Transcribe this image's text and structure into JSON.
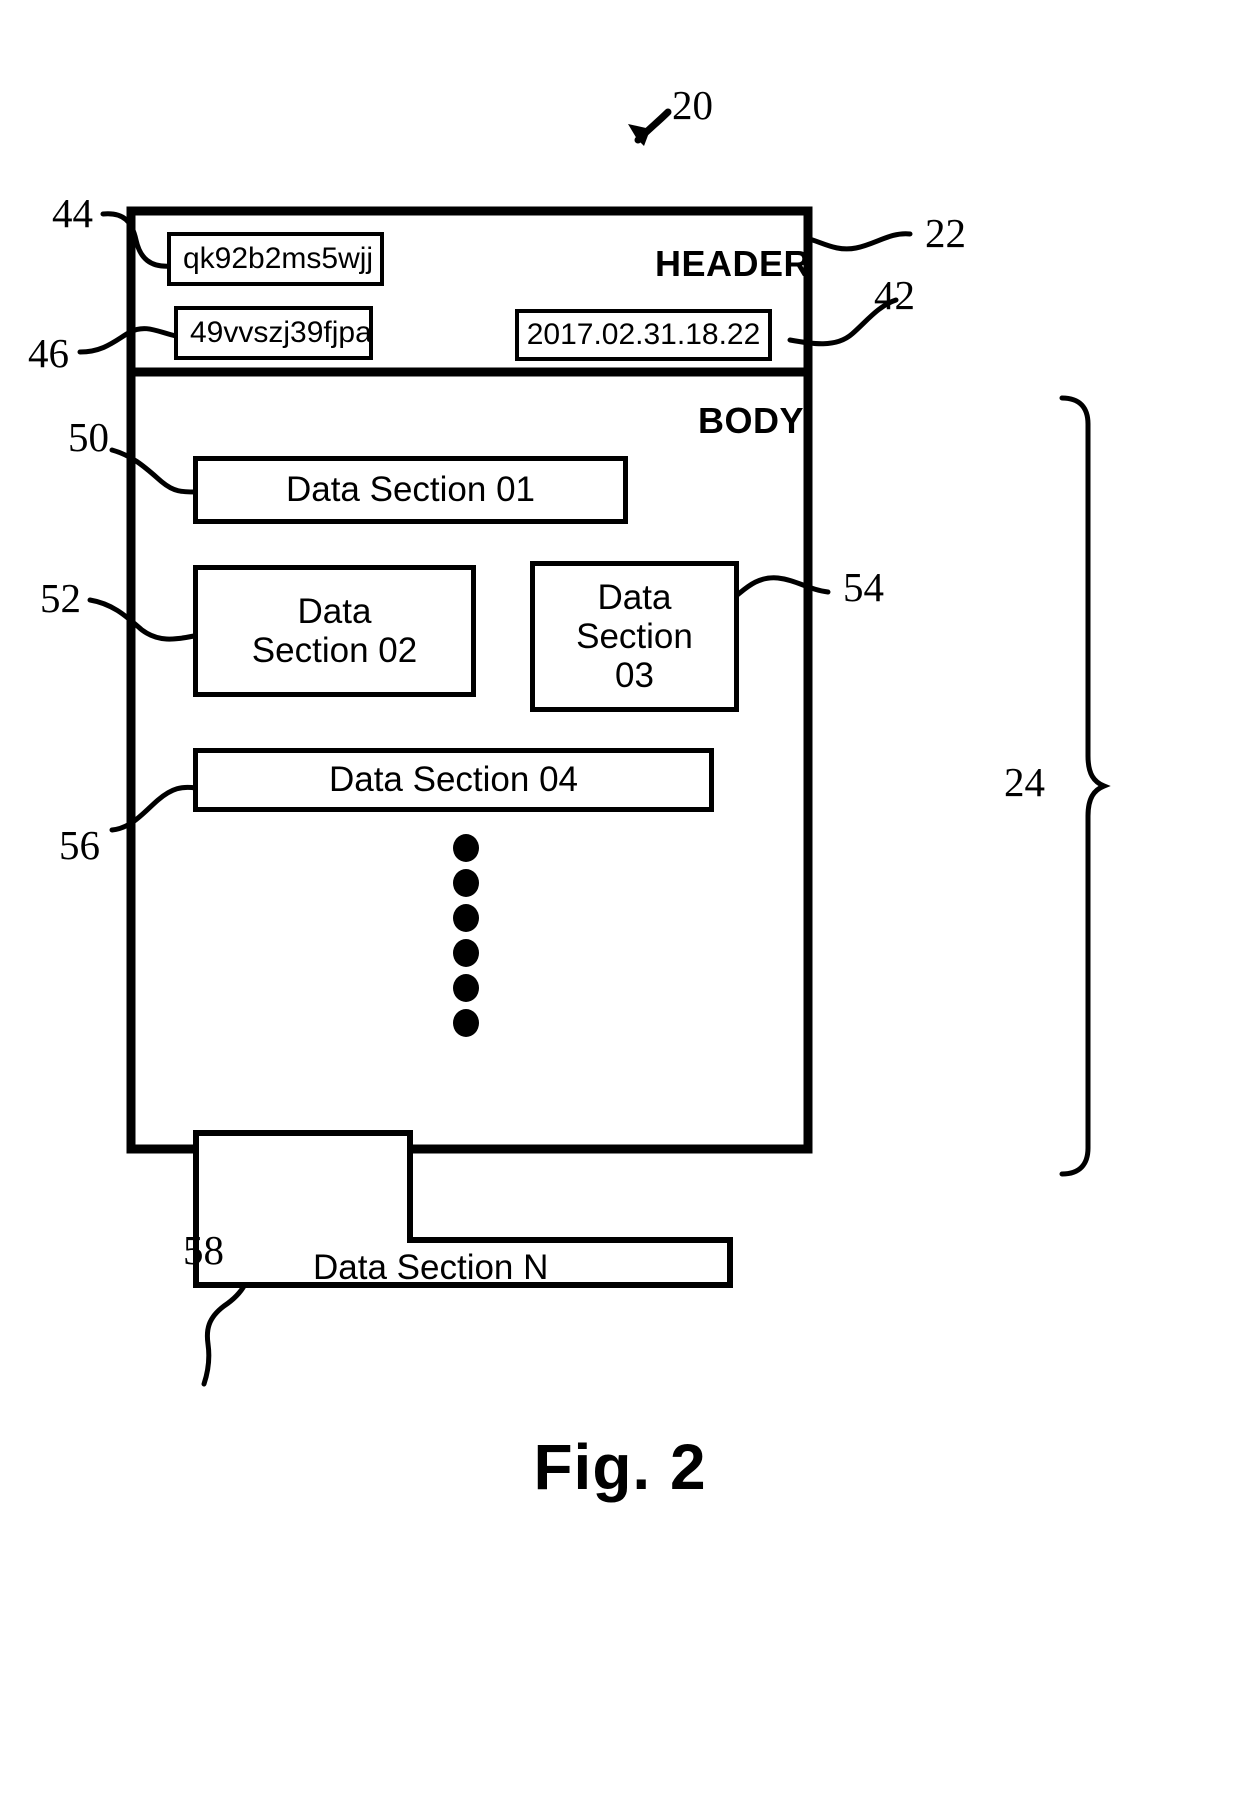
{
  "figure": {
    "caption": "Fig. 2",
    "overall_ref": "20"
  },
  "structure": {
    "header": {
      "label": "HEADER",
      "ref": "22",
      "fields": [
        {
          "ref": "44",
          "value": "qk92b2ms5wjj"
        },
        {
          "ref": "46",
          "value": "49vvszj39fjpa"
        },
        {
          "ref": "42",
          "value": "2017.02.31.18.22"
        }
      ]
    },
    "body": {
      "label": "BODY",
      "ref": "24",
      "sections": [
        {
          "ref": "50",
          "label": "Data Section 01"
        },
        {
          "ref": "52",
          "label": "Data\nSection 02"
        },
        {
          "ref": "54",
          "label": "Data\nSection\n03"
        },
        {
          "ref": "56",
          "label": "Data Section 04"
        },
        {
          "ref": "58",
          "label": "Data Section N"
        }
      ],
      "continuation_marker": "vertical-ellipsis",
      "continuation_dot_count": 6
    }
  },
  "refs": {
    "n20": "20",
    "n22": "22",
    "n24": "24",
    "n42": "42",
    "n44": "44",
    "n46": "46",
    "n50": "50",
    "n52": "52",
    "n54": "54",
    "n56": "56",
    "n58": "58"
  },
  "colors": {
    "ink": "#000000",
    "paper": "#ffffff"
  }
}
